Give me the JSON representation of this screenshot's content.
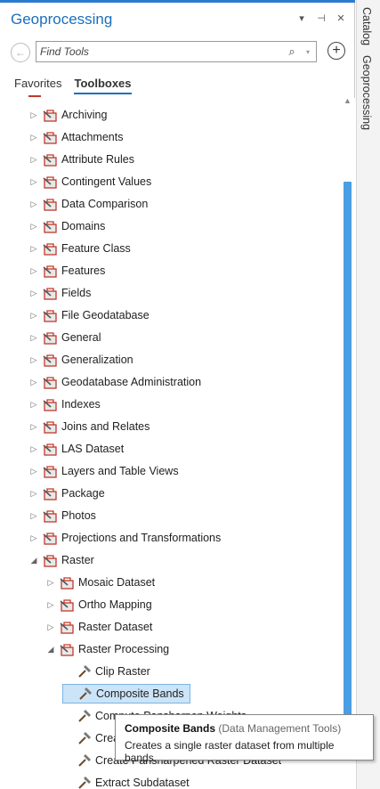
{
  "pane": {
    "title": "Geoprocessing",
    "controls": {
      "dropdown": "▾",
      "pin": "⊣",
      "close": "✕"
    }
  },
  "search": {
    "placeholder": "Find Tools",
    "back_glyph": "←",
    "search_glyph": "⌕",
    "dropdown_glyph": "▾",
    "add_glyph": "+"
  },
  "tabs": [
    "Favorites",
    "Toolboxes"
  ],
  "active_tab": "Toolboxes",
  "tree": {
    "toolsets": [
      "Archiving",
      "Attachments",
      "Attribute Rules",
      "Contingent Values",
      "Data Comparison",
      "Domains",
      "Feature Class",
      "Features",
      "Fields",
      "File Geodatabase",
      "General",
      "Generalization",
      "Geodatabase Administration",
      "Indexes",
      "Joins and Relates",
      "LAS Dataset",
      "Layers and Table Views",
      "Package",
      "Photos",
      "Projections and Transformations",
      "Raster"
    ],
    "raster_children": [
      "Mosaic Dataset",
      "Ortho Mapping",
      "Raster Dataset",
      "Raster Processing"
    ],
    "raster_processing_tools": [
      "Clip Raster",
      "Composite Bands",
      "Compute Pansharpen Weights",
      "Create Ortho Corrected Raster Dataset",
      "Create Pansharpened Raster Dataset",
      "Extract Subdataset"
    ],
    "selected_tool": "Composite Bands"
  },
  "side_tabs": [
    "Catalog",
    "Geoprocessing"
  ],
  "tooltip": {
    "title": "Composite Bands",
    "toolbox": "(Data Management Tools)",
    "description": "Creates a single raster dataset from multiple bands."
  },
  "colors": {
    "accent": "#1a6fbd",
    "selection": "#cce4f7",
    "scrollbar": "#4a9ee3",
    "toolbox_icon": "#c0392b"
  },
  "icons": {
    "toolset": "toolbox-icon",
    "tool": "hammer-icon",
    "collapsed": "triangle-right-icon",
    "expanded": "triangle-down-icon"
  }
}
